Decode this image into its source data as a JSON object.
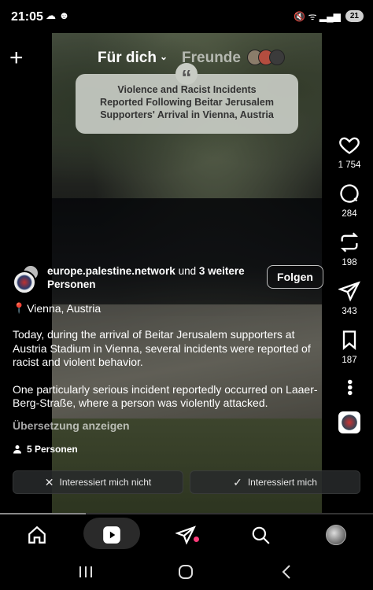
{
  "status_bar": {
    "time": "21:05",
    "notification_icons": "☁ ☻",
    "right_icons": "🔇 ᯤ ▂▄▆",
    "battery": "21"
  },
  "top_bar": {
    "tab_for_you": "Für dich",
    "tab_friends": "Freunde",
    "add_icon": "plus-icon"
  },
  "quote_card": {
    "text_line1": "Violence and Racist Incidents",
    "text_line2": "Reported Following Beitar Jerusalem",
    "text_line3": "Supporters' Arrival in Vienna, Austria"
  },
  "actions": {
    "likes": "1 754",
    "comments": "284",
    "reposts": "198",
    "shares": "343",
    "saves": "187"
  },
  "post": {
    "author": "europe.palestine.network",
    "coauthors_connector": "und",
    "coauthors_count_text": "3 weitere",
    "coauthors_suffix": "Personen",
    "follow_label": "Folgen",
    "location": "Vienna, Austria",
    "caption_p1": "Today, during the arrival of Beitar Jerusalem supporters at Austria Stadium in Vienna, several incidents were reported of racist and violent behavior.",
    "caption_p2": "One particularly serious incident reportedly occurred on Laaer-Berg-Straße, where a person was violently attacked.",
    "translate_label": "Übersetzung anzeigen",
    "people_label": "5 Personen"
  },
  "feedback": {
    "not_interested": "Interessiert mich nicht",
    "interested": "Interessiert mich"
  },
  "video_progress": 0.23,
  "colors": {
    "accent_notification": "#ff3b7a",
    "location_pin": "#e0483e"
  }
}
